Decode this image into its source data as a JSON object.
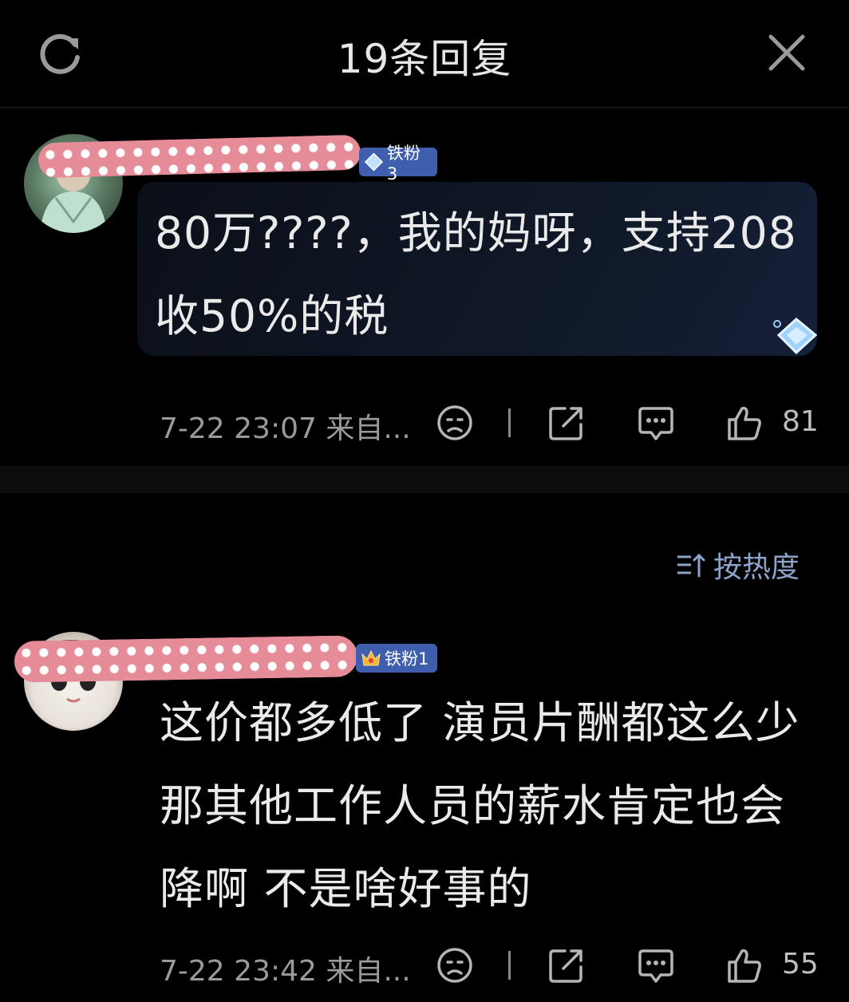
{
  "header": {
    "title": "19条回复",
    "refresh_icon": "refresh-icon",
    "close_icon": "close-icon"
  },
  "main_comment": {
    "fan_badge": "铁粉3",
    "text": "80万????，我的妈呀，支持208收50%的税",
    "time": "7-22 23:07",
    "source": "来自...",
    "likes": "81"
  },
  "sort": {
    "label": "按热度",
    "icon": "sort-icon"
  },
  "replies": [
    {
      "fan_badge": "铁粉1",
      "text": "这价都多低了 演员片酬都这么少那其他工作人员的薪水肯定也会降啊 不是啥好事的",
      "time": "7-22 23:42",
      "source": "来自...",
      "likes": "55"
    }
  ],
  "colors": {
    "background": "#000000",
    "badge": "#3f5fae",
    "sort_text": "#8ea3c9",
    "meta_text": "#9a9a9a",
    "name_mask": "#e58c98"
  }
}
